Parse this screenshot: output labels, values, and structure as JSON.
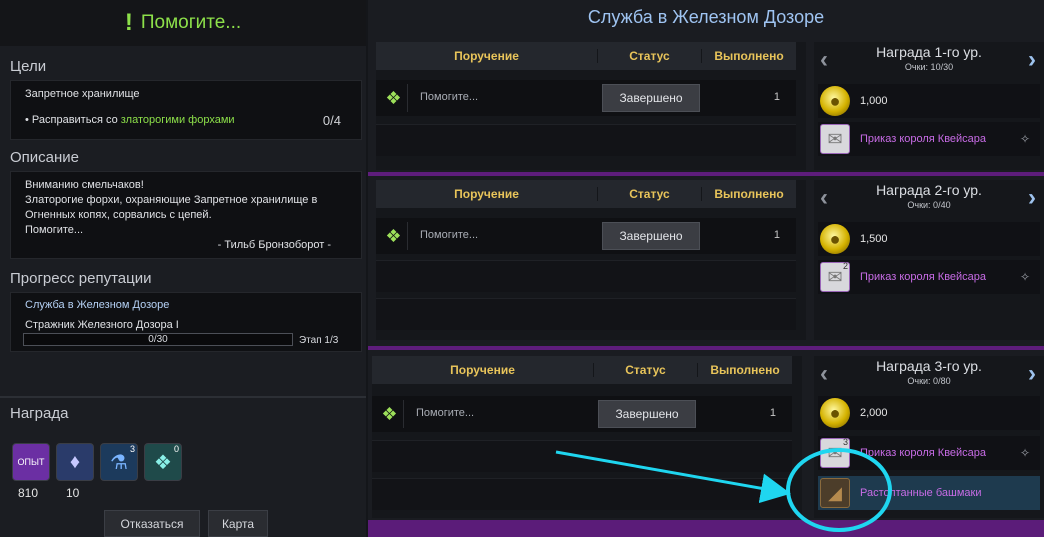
{
  "left": {
    "quest_title": "Помогите...",
    "goals": {
      "title": "Цели",
      "area": "Запретное хранилище",
      "task_prefix": "• Расправиться со",
      "task_highlight": "златорогими форхами",
      "count": "0/4"
    },
    "description": {
      "title": "Описание",
      "lines": [
        "Вниманию смельчаков!",
        "Златорогие форхи, охраняющие Запретное хранилище в",
        "Огненных копях, сорвались с цепей.",
        "Помогите..."
      ],
      "signature": "- Тильб Бронзоборот -"
    },
    "reputation": {
      "title": "Прогресс репутации",
      "faction": "Служба в Железном Дозоре",
      "rank": "Стражник Железного Дозора I",
      "progress_text": "0/30",
      "progress_fraction": 0,
      "stage": "Этап 1/3"
    },
    "reward": {
      "title": "Награда",
      "items": [
        {
          "icon": "exp-icon",
          "glyph": "ОПЫТ",
          "value": "810",
          "color": "#7b3fb5"
        },
        {
          "icon": "diamond-icon",
          "glyph": "♦",
          "value": "10",
          "color": "#2a3b6a"
        },
        {
          "icon": "potion-icon",
          "glyph": "⚗",
          "badge": "3",
          "color": "#1c3a5c"
        },
        {
          "icon": "crystal-heart-icon",
          "glyph": "❖",
          "badge": "0",
          "color": "#1f4a4a"
        }
      ]
    },
    "buttons": {
      "refuse": "Отказаться",
      "map": "Карта"
    }
  },
  "right": {
    "title": "Служба в Железном Дозоре",
    "table_header": {
      "task": "Поручение",
      "status": "Статус",
      "done": "Выполнено"
    },
    "tiers": [
      {
        "task": "Помогите...",
        "status": "Завершено",
        "done": "1",
        "reward_level": "Награда 1-го ур.",
        "points": "Очки: 10/30",
        "silver": "1,000",
        "scroll_name": "Приказ короля Квейсара",
        "scroll_badge": ""
      },
      {
        "task": "Помогите...",
        "status": "Завершено",
        "done": "1",
        "reward_level": "Награда 2-го ур.",
        "points": "Очки: 0/40",
        "silver": "1,500",
        "scroll_name": "Приказ короля Квейсара",
        "scroll_badge": "2"
      },
      {
        "task": "Помогите...",
        "status": "Завершено",
        "done": "1",
        "reward_level": "Награда 3-го ур.",
        "points": "Очки: 0/80",
        "silver": "2,000",
        "scroll_name": "Приказ короля Квейсара",
        "scroll_badge": "3",
        "extra_item": "Растоптанные башмаки"
      }
    ]
  },
  "colors": {
    "accent_green": "#8de04a",
    "header_gold": "#e8c45a",
    "purple_band": "#5e1d7c",
    "item_purple": "#c86ce6",
    "annotation_cyan": "#1fd6f0"
  }
}
